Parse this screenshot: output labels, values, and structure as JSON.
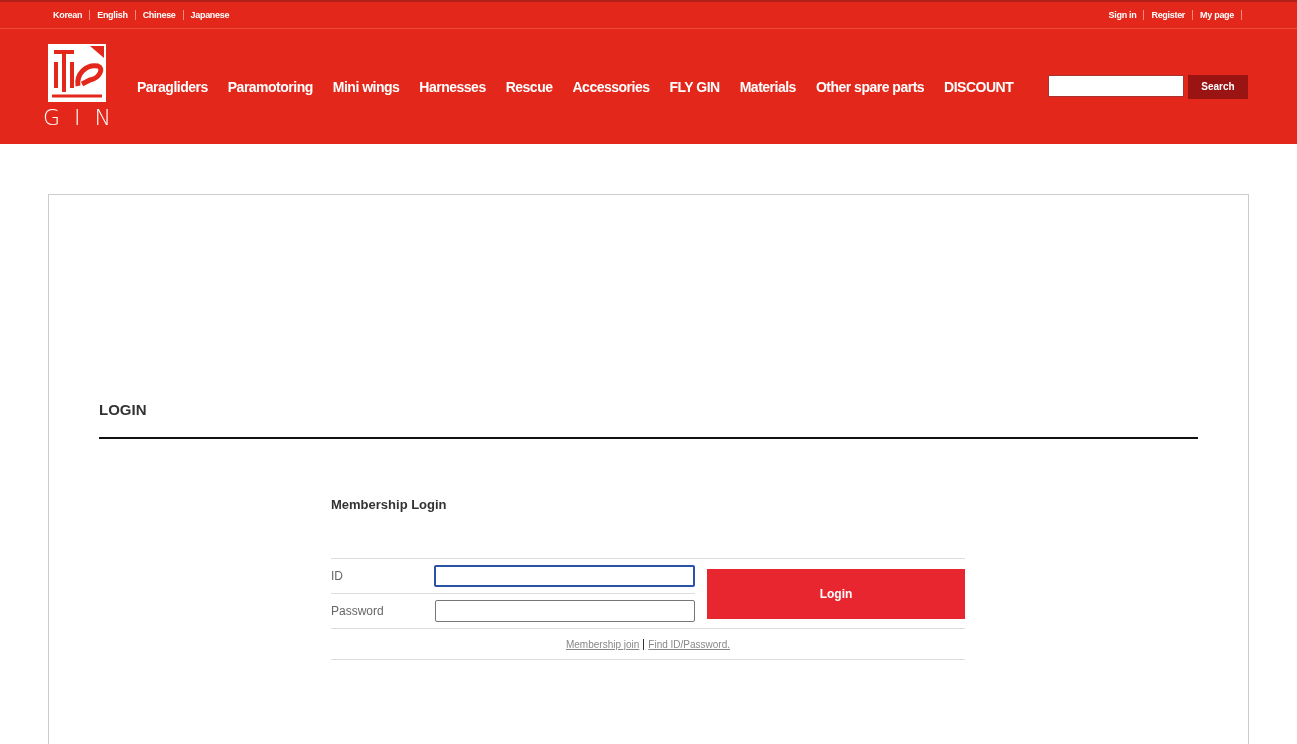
{
  "languages": [
    {
      "label": "Korean"
    },
    {
      "label": "English"
    },
    {
      "label": "Chinese"
    },
    {
      "label": "Japanese"
    }
  ],
  "account_links": [
    {
      "label": "Sign in"
    },
    {
      "label": "Register"
    },
    {
      "label": "My page"
    }
  ],
  "logo": {
    "text": "GIN"
  },
  "nav": [
    {
      "label": "Paragliders"
    },
    {
      "label": "Paramotoring"
    },
    {
      "label": "Mini wings"
    },
    {
      "label": "Harnesses"
    },
    {
      "label": "Rescue"
    },
    {
      "label": "Accessories"
    },
    {
      "label": "FLY GIN"
    },
    {
      "label": "Materials"
    },
    {
      "label": "Other spare parts"
    },
    {
      "label": "DISCOUNT"
    }
  ],
  "search": {
    "button": "Search"
  },
  "page_title": "LOGIN",
  "login": {
    "title": "Membership Login",
    "fields": [
      {
        "label": "ID",
        "focused": true
      },
      {
        "label": "Password",
        "focused": false
      }
    ],
    "button": "Login",
    "links": [
      {
        "label": "Membership join"
      },
      {
        "label": "Find ID/Password."
      }
    ]
  }
}
